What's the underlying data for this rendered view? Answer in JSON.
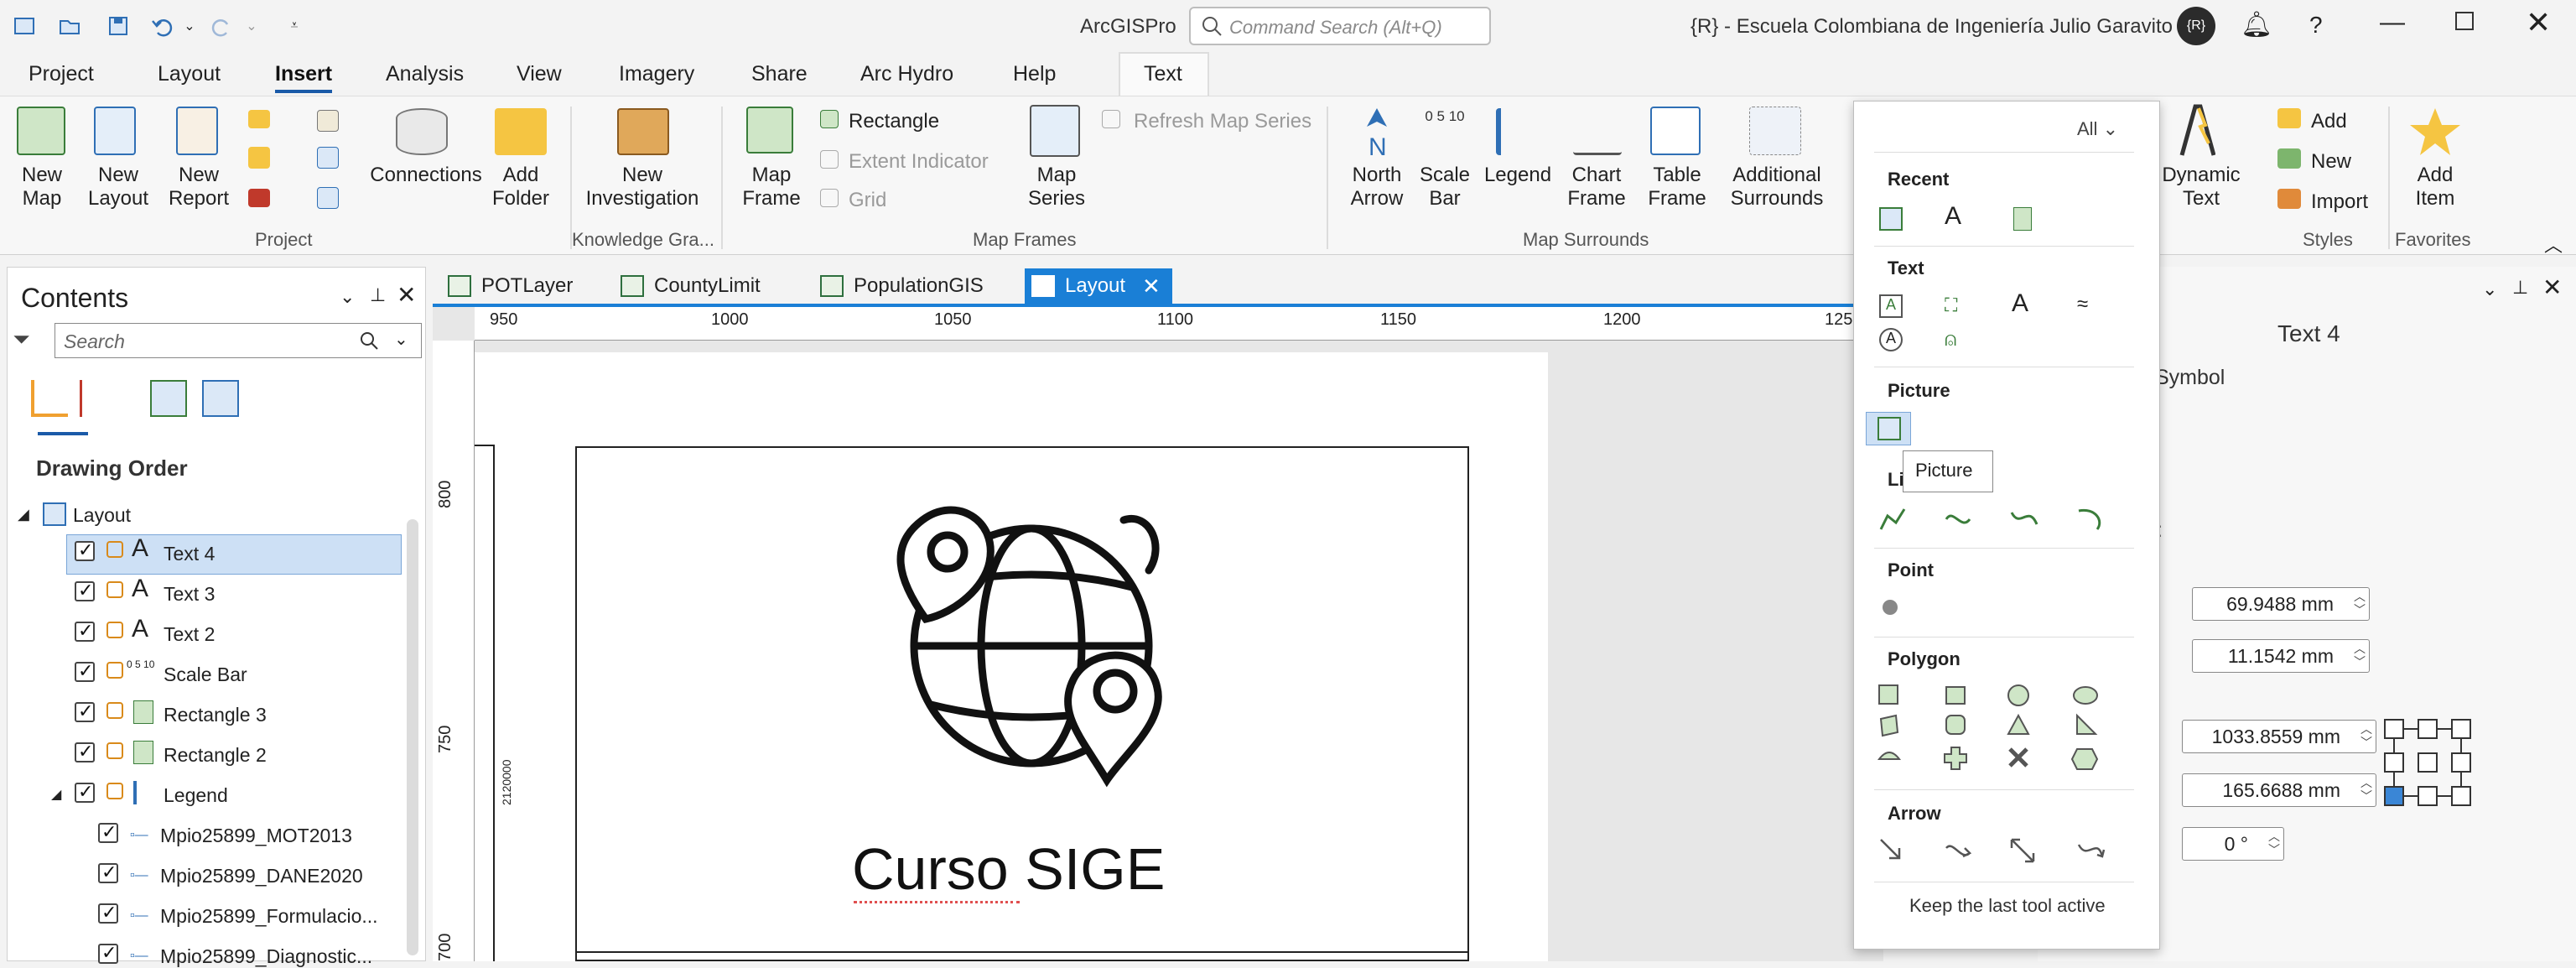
{
  "app": {
    "title": "ArcGISPro",
    "search_placeholder": "Command Search (Alt+Q)",
    "organization": "{R} - Escuela Colombiana de Ingeniería Julio Garavito",
    "avatar_initials": "{R}"
  },
  "tabs": [
    "Project",
    "Layout",
    "Insert",
    "Analysis",
    "View",
    "Imagery",
    "Share",
    "Arc Hydro",
    "Help",
    "Text"
  ],
  "ribbon": {
    "project": {
      "new_map": "New\nMap",
      "new_layout": "New\nLayout",
      "new_report": "New\nReport",
      "connections": "Connections",
      "add_folder": "Add\nFolder",
      "group": "Project"
    },
    "knowledge": {
      "new_investigation": "New\nInvestigation",
      "group": "Knowledge Gra..."
    },
    "map_frames": {
      "map_frame": "Map\nFrame",
      "rectangle": "Rectangle",
      "extent_indicator": "Extent Indicator",
      "grid": "Grid",
      "map_series": "Map\nSeries",
      "refresh": "Refresh Map Series",
      "group": "Map Frames"
    },
    "surrounds": {
      "north_arrow": "North\nArrow",
      "scale_bar": "Scale\nBar",
      "legend": "Legend",
      "chart_frame": "Chart\nFrame",
      "table_frame": "Table\nFrame",
      "additional": "Additional\nSurrounds",
      "scale_digits": "0 5 10",
      "group": "Map Surrounds"
    },
    "styles": {
      "dynamic_text": "Dynamic\nText",
      "add": "Add",
      "new": "New",
      "import": "Import",
      "group": "Styles"
    },
    "favorites": {
      "add_item": "Add\nItem",
      "group": "Favorites"
    }
  },
  "contents": {
    "title": "Contents",
    "search_placeholder": "Search",
    "drawing_order": "Drawing Order",
    "items": [
      {
        "label": "Layout",
        "level": 0
      },
      {
        "label": "Text 4",
        "level": 1,
        "selected": true
      },
      {
        "label": "Text 3",
        "level": 1
      },
      {
        "label": "Text 2",
        "level": 1
      },
      {
        "label": "Scale Bar",
        "level": 1
      },
      {
        "label": "Rectangle 3",
        "level": 1
      },
      {
        "label": "Rectangle 2",
        "level": 1
      },
      {
        "label": "Legend",
        "level": 1
      },
      {
        "label": "Mpio25899_MOT2013",
        "level": 2
      },
      {
        "label": "Mpio25899_DANE2020",
        "level": 2
      },
      {
        "label": "Mpio25899_Formulacio...",
        "level": 2
      },
      {
        "label": "Mpio25899_Diagnostic...",
        "level": 2
      }
    ],
    "scale_icon_text": "0 5 10"
  },
  "doc_tabs": [
    "POTLayer",
    "CountyLimit",
    "PopulationGIS",
    "Layout"
  ],
  "ruler": {
    "top": [
      "950",
      "1000",
      "1050",
      "1100",
      "1150",
      "1200",
      "125"
    ],
    "left": [
      "800",
      "750",
      "700"
    ],
    "side_label": "2120000"
  },
  "layout_text": "Curso SIGE",
  "gallery": {
    "filter": "All",
    "sections": {
      "recent": "Recent",
      "text": "Text",
      "picture": "Picture",
      "line": "Li",
      "point": "Point",
      "polygon": "Polygon",
      "arrow": "Arrow"
    },
    "tooltip": "Picture",
    "keep_tool": "Keep the last tool active"
  },
  "props": {
    "title": "Text 4",
    "symbol": "Symbol",
    "colon": ":",
    "width": "69.9488 mm",
    "height": "11.1542 mm",
    "x": "1033.8559 mm",
    "y": "165.6688 mm",
    "rotation": "0 °"
  }
}
